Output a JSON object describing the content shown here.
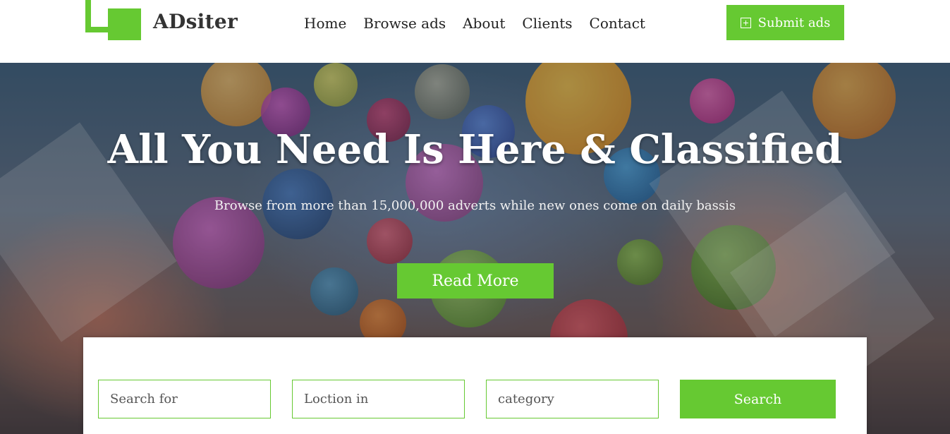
{
  "brand": {
    "name": "ADsiter"
  },
  "nav": {
    "items": [
      {
        "label": "Home"
      },
      {
        "label": "Browse ads"
      },
      {
        "label": "About"
      },
      {
        "label": "Clients"
      },
      {
        "label": "Contact"
      }
    ]
  },
  "header": {
    "submit_label": "Submit ads"
  },
  "hero": {
    "title": "All You Need Is Here & Classified",
    "subtitle": "Browse from more than 15,000,000 adverts while new ones come on daily bassis",
    "cta_label": "Read More"
  },
  "search": {
    "keyword_placeholder": "Search for",
    "location_placeholder": "Loction in",
    "category_placeholder": "category",
    "button_label": "Search"
  },
  "colors": {
    "accent": "#66c932",
    "text_dark": "#222222",
    "white": "#ffffff"
  }
}
